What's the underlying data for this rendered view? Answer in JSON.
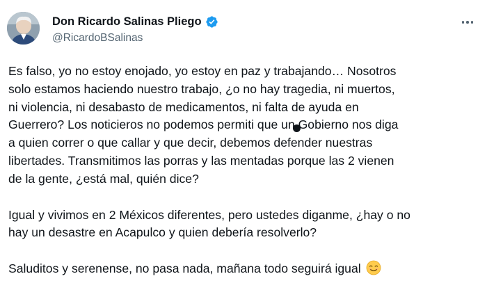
{
  "author": {
    "display_name": "Don Ricardo Salinas Pliego",
    "handle": "@RicardoBSalinas",
    "verified": true,
    "verified_color": "#1d9bf0"
  },
  "menu": {
    "icon": "more-horizontal-icon"
  },
  "tweet": {
    "paragraphs": [
      {
        "lines": [
          "Es falso, yo no estoy enojado, yo estoy en paz y trabajando… Nosotros",
          "solo estamos haciendo nuestro trabajo, ¿o no hay tragedia, ni muertos,",
          "ni violencia, ni desabasto de medicamentos, ni falta de ayuda en",
          "Guerrero? Los noticieros no podemos permiti  que un Gobierno nos diga",
          "a quien correr o que callar y que decir, debemos defender nuestras",
          "libertades. Transmitimos las porras y las mentadas porque las 2 vienen",
          "de la gente, ¿está mal, quién dice?"
        ]
      },
      {
        "lines": [
          "Igual y vivimos en 2 Méxicos diferentes, pero ustedes diganme, ¿hay o no",
          "hay un desastre en Acapulco y quien debería resolverlo?"
        ]
      },
      {
        "lines": [
          "Saluditos y serenense, no pasa nada, mañana todo seguirá igual"
        ],
        "emoji": "relieved-face-emoji"
      }
    ]
  },
  "colors": {
    "text": "#0f1419",
    "secondary": "#536471",
    "accent": "#1d9bf0"
  }
}
